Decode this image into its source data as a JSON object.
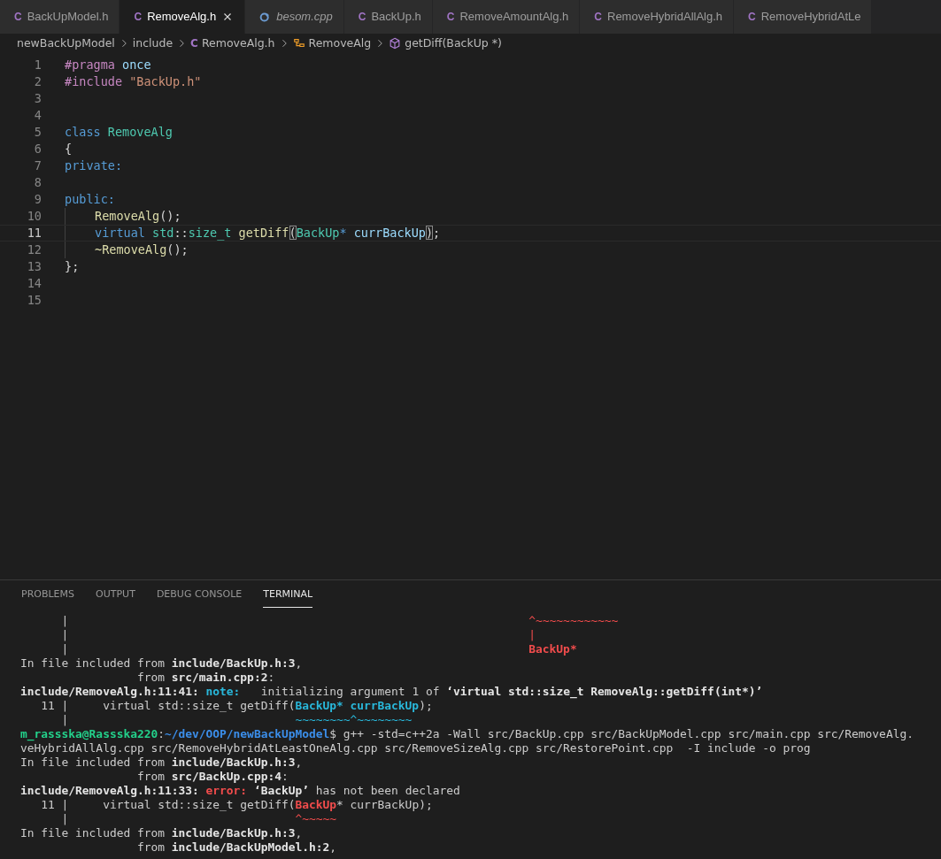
{
  "tabs": [
    {
      "label": "BackUpModel.h",
      "kind": "header",
      "icon": "C",
      "selected": false,
      "preview": false
    },
    {
      "label": "RemoveAlg.h",
      "kind": "header",
      "icon": "C",
      "selected": true,
      "preview": false
    },
    {
      "label": "besom.cpp",
      "kind": "source",
      "selected": false,
      "preview": true
    },
    {
      "label": "BackUp.h",
      "kind": "header",
      "icon": "C",
      "selected": false,
      "preview": false
    },
    {
      "label": "RemoveAmountAlg.h",
      "kind": "header",
      "icon": "C",
      "selected": false,
      "preview": false
    },
    {
      "label": "RemoveHybridAllAlg.h",
      "kind": "header",
      "icon": "C",
      "selected": false,
      "preview": false
    },
    {
      "label": "RemoveHybridAtLe",
      "kind": "header",
      "icon": "C",
      "selected": false,
      "preview": false
    }
  ],
  "breadcrumbs": [
    {
      "label": "newBackUpModel",
      "kind": "folder"
    },
    {
      "label": "include",
      "kind": "folder"
    },
    {
      "label": "RemoveAlg.h",
      "kind": "file",
      "icon": "C"
    },
    {
      "label": "RemoveAlg",
      "kind": "class"
    },
    {
      "label": "getDiff(BackUp *)",
      "kind": "method"
    }
  ],
  "code_lines": [
    {
      "number": "1",
      "current": false,
      "tokens": [
        {
          "kind": "directive",
          "text": "#pragma"
        },
        {
          "kind": "variable",
          "text": " once"
        }
      ]
    },
    {
      "number": "2",
      "current": false,
      "tokens": [
        {
          "kind": "directive",
          "text": "#include"
        },
        {
          "kind": "string",
          "text": " \"BackUp.h\""
        }
      ]
    },
    {
      "number": "3",
      "current": false
    },
    {
      "number": "4",
      "current": false
    },
    {
      "number": "5",
      "current": false,
      "tokens": [
        {
          "kind": "keyword",
          "text": "class"
        },
        {
          "kind": "type",
          "text": " RemoveAlg"
        }
      ]
    },
    {
      "number": "6",
      "current": false,
      "tokens": [
        {
          "kind": "plain",
          "text": "{"
        }
      ]
    },
    {
      "number": "7",
      "current": false,
      "tokens": [
        {
          "kind": "keyword",
          "text": "private:"
        }
      ]
    },
    {
      "number": "8",
      "current": false
    },
    {
      "number": "9",
      "current": false,
      "tokens": [
        {
          "kind": "keyword",
          "text": "public:"
        }
      ]
    },
    {
      "number": "10",
      "current": false,
      "indent": true,
      "tokens": [
        {
          "kind": "function",
          "text": "RemoveAlg"
        },
        {
          "kind": "plain",
          "text": "();"
        }
      ]
    },
    {
      "number": "11",
      "current": true,
      "indent": true,
      "tokens": [
        {
          "kind": "keyword",
          "text": "virtual"
        },
        {
          "kind": "type",
          "text": " std"
        },
        {
          "kind": "plain",
          "text": "::"
        },
        {
          "kind": "type",
          "text": "size_t"
        },
        {
          "kind": "function",
          "text": " getDiff"
        },
        {
          "kind": "bracket",
          "text": "("
        },
        {
          "kind": "type",
          "text": "BackUp"
        },
        {
          "kind": "keyword",
          "text": "*"
        },
        {
          "kind": "variable",
          "text": " currBackUp"
        },
        {
          "kind": "bracket",
          "text": ")"
        },
        {
          "kind": "plain",
          "text": ";"
        }
      ]
    },
    {
      "number": "12",
      "current": false,
      "indent": true,
      "tokens": [
        {
          "kind": "function",
          "text": "~RemoveAlg"
        },
        {
          "kind": "plain",
          "text": "();"
        }
      ]
    },
    {
      "number": "13",
      "current": false,
      "tokens": [
        {
          "kind": "plain",
          "text": "};"
        }
      ]
    },
    {
      "number": "14",
      "current": false
    },
    {
      "number": "15",
      "current": false
    }
  ],
  "panel_tabs": [
    {
      "label": "PROBLEMS",
      "selected": false
    },
    {
      "label": "OUTPUT",
      "selected": false
    },
    {
      "label": "DEBUG CONSOLE",
      "selected": false
    },
    {
      "label": "TERMINAL",
      "selected": true
    }
  ],
  "terminal_lines": [
    [
      {
        "kind": "plain",
        "text": "      |                                                                   "
      },
      {
        "kind": "error",
        "text": "^~~~~~~~~~~~~"
      }
    ],
    [
      {
        "kind": "plain",
        "text": "      |                                                                   "
      },
      {
        "kind": "error",
        "text": "|"
      }
    ],
    [
      {
        "kind": "plain",
        "text": "      |                                                                   "
      },
      {
        "kind": "error-bold",
        "text": "BackUp*"
      }
    ],
    [
      {
        "kind": "plain",
        "text": "In file included from "
      },
      {
        "kind": "bold",
        "text": "include/BackUp.h:3"
      },
      {
        "kind": "plain",
        "text": ","
      }
    ],
    [
      {
        "kind": "plain",
        "text": "                 from "
      },
      {
        "kind": "bold",
        "text": "src/main.cpp:2"
      },
      {
        "kind": "plain",
        "text": ":"
      }
    ],
    [
      {
        "kind": "bold",
        "text": "include/RemoveAlg.h:11:41:"
      },
      {
        "kind": "note-bold",
        "text": " note:"
      },
      {
        "kind": "plain",
        "text": "   initializing argument 1 of "
      },
      {
        "kind": "bold",
        "text": "‘virtual std::size_t RemoveAlg::getDiff(int*)’"
      }
    ],
    [
      {
        "kind": "plain",
        "text": "   11 |     virtual std::size_t getDiff("
      },
      {
        "kind": "note-bold",
        "text": "BackUp* currBackUp"
      },
      {
        "kind": "plain",
        "text": ");"
      }
    ],
    [
      {
        "kind": "plain",
        "text": "      |                                 "
      },
      {
        "kind": "note",
        "text": "~~~~~~~~^~~~~~~~~"
      }
    ],
    [
      {
        "kind": "prompt-user",
        "text": "m_rassska@Rassska220"
      },
      {
        "kind": "plain",
        "text": ":"
      },
      {
        "kind": "prompt-path",
        "text": "~/dev/OOP/newBackUpModel"
      },
      {
        "kind": "plain",
        "text": "$ g++ -std=c++2a -Wall src/BackUp.cpp src/BackUpModel.cpp src/main.cpp src/RemoveAlg."
      }
    ],
    [
      {
        "kind": "plain",
        "text": "veHybridAllAlg.cpp src/RemoveHybridAtLeastOneAlg.cpp src/RemoveSizeAlg.cpp src/RestorePoint.cpp  -I include -o prog"
      }
    ],
    [
      {
        "kind": "plain",
        "text": "In file included from "
      },
      {
        "kind": "bold",
        "text": "include/BackUp.h:3"
      },
      {
        "kind": "plain",
        "text": ","
      }
    ],
    [
      {
        "kind": "plain",
        "text": "                 from "
      },
      {
        "kind": "bold",
        "text": "src/BackUp.cpp:4"
      },
      {
        "kind": "plain",
        "text": ":"
      }
    ],
    [
      {
        "kind": "bold",
        "text": "include/RemoveAlg.h:11:33:"
      },
      {
        "kind": "error-bold",
        "text": " error:"
      },
      {
        "kind": "bold",
        "text": " ‘BackUp’"
      },
      {
        "kind": "plain",
        "text": " has not been declared"
      }
    ],
    [
      {
        "kind": "plain",
        "text": "   11 |     virtual std::size_t getDiff("
      },
      {
        "kind": "error-bold",
        "text": "BackUp"
      },
      {
        "kind": "plain",
        "text": "* currBackUp);"
      }
    ],
    [
      {
        "kind": "plain",
        "text": "      |                                 "
      },
      {
        "kind": "error",
        "text": "^~~~~~"
      }
    ],
    [
      {
        "kind": "plain",
        "text": "In file included from "
      },
      {
        "kind": "bold",
        "text": "include/BackUp.h:3"
      },
      {
        "kind": "plain",
        "text": ","
      }
    ],
    [
      {
        "kind": "plain",
        "text": "                 from "
      },
      {
        "kind": "bold",
        "text": "include/BackUpModel.h:2"
      },
      {
        "kind": "plain",
        "text": ","
      }
    ]
  ]
}
